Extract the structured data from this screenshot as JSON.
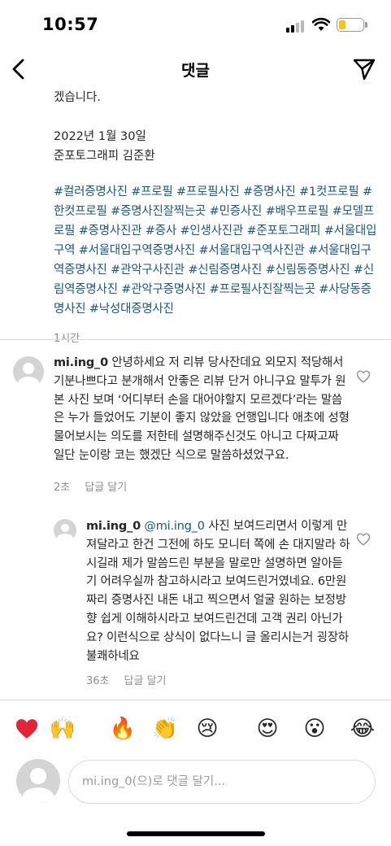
{
  "status_bar": {
    "time": "10:57"
  },
  "nav": {
    "title": "댓글"
  },
  "caption": {
    "text_top": "겠습니다.",
    "date": "2022년 1월 30일",
    "author": "준포토그래피 김준환",
    "hashtags": [
      "#컬러증명사진",
      "#프로필",
      "#프로필사진",
      "#증명사진",
      "#1컷프로필",
      "#한컷프로필",
      "#증명사진잘찍는곳",
      "#민증사진",
      "#배우프로필",
      "#모델프로필",
      "#증명사진관",
      "#증사",
      "#인생사진관",
      "#준포토그래피",
      "#서울대입구역",
      "#서울대입구역증명사진",
      "#서울대입구역사진관",
      "#서울대입구역증명사진",
      "#관악구사진관",
      "#신림증명사진",
      "#신림동증명사진",
      "#신림역증명사진",
      "#관악구증명사진",
      "#프로필사진잘찍는곳",
      "#사당동증명사진",
      "#낙성대증명사진"
    ],
    "time": "1시간"
  },
  "comments": [
    {
      "username": "mi.ing_0",
      "text": "안녕하세요 저 리뷰 당사잔데요 외모지 적당해서 기분나쁘다고 분개해서 안좋은 리뷰 단거 아니구요 말투가 원본 사진 보며 ‘어디부터 손을 대어야할지 모르겠다’라는 말씀은 누가 들었어도 기분이 좋지 않았을 언행입니다 애초에 성형 물어보시는 의도를 저한테 설명해주신것도 아니고 다짜고짜 일단 눈이랑 코는 했겠단 식으로 말씀하셨었구요.",
      "time": "2초",
      "reply_label": "답글 달기"
    },
    {
      "username": "mi.ing_0",
      "mention": "@mi.ing_0",
      "text": "사진 보여드리면서 이렇게 만져달라고 한건 그전에 하도 모니터 쪽에 손 대지말라 하시길래 제가 말씀드린 부분을 말로만 설명하면 알아듣기 어려우실까 참고하시라고 보여드린거였네요. 6만원짜리 증명사진 내돈 내고 찍으면서 얼굴 원하는 보정방향 쉽게 이해하시라고 보여드린건데 고객 권리 아닌가요? 이런식으로 상식이 없다느니 글 올리시는거 굉장하 불쾌하네요",
      "time": "36초",
      "reply_label": "답글 달기"
    }
  ],
  "emoji_bar": {
    "items": [
      {
        "name": "heart-emoji",
        "glyph": "❤️"
      },
      {
        "name": "raised-hands-emoji",
        "glyph": "🙌"
      },
      {
        "name": "fire-emoji",
        "glyph": "🔥"
      },
      {
        "name": "clapping-hands-emoji",
        "glyph": "👏"
      },
      {
        "name": "crying-face-emoji",
        "glyph": "😢"
      },
      {
        "name": "heart-eyes-emoji",
        "glyph": "😍"
      },
      {
        "name": "astonished-face-emoji",
        "glyph": "😮"
      },
      {
        "name": "tears-of-joy-emoji",
        "glyph": "😂"
      }
    ]
  },
  "comment_input": {
    "placeholder": "mi.ing_0(으)로 댓글 달기..."
  },
  "colors": {
    "hashtag": "#1a5687",
    "meta": "#8e8e8e",
    "battery": "#f5c518"
  }
}
